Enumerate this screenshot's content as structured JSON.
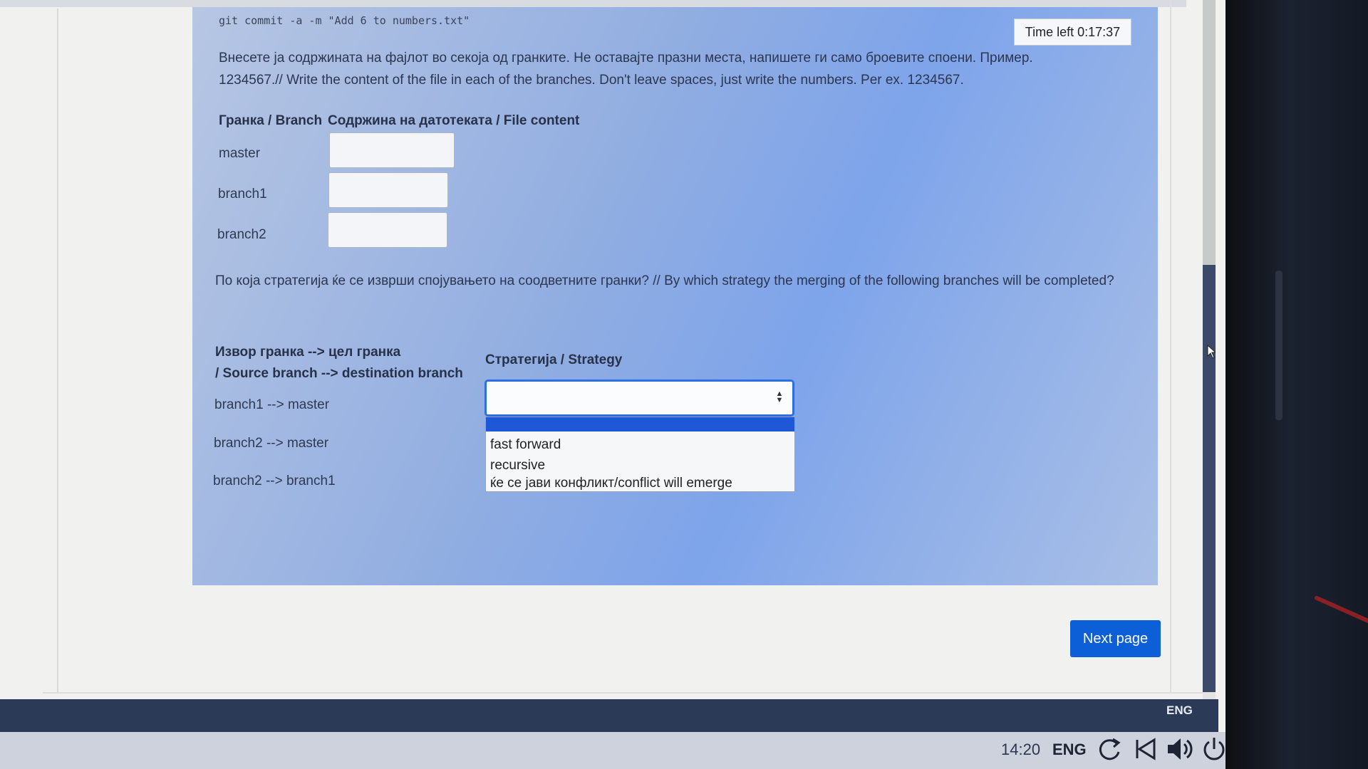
{
  "exam": {
    "command_line": "git commit -a -m \"Add 6 to numbers.txt\"",
    "timer": "Time left 0:17:37",
    "instructions": "Внесете ја содржината на фајлот во секоја од гранките. Не оставајте празни места, напишете ги само броевите споени. Пример. 1234567.// Write the content of the file in each of the branches. Don't leave spaces, just write the numbers. Per ex. 1234567.",
    "table1": {
      "header_branch": "Гранка / Branch",
      "header_content": "Содржина на датотеката / File content",
      "rows": [
        {
          "label": "master",
          "value": ""
        },
        {
          "label": "branch1",
          "value": ""
        },
        {
          "label": "branch2",
          "value": ""
        }
      ]
    },
    "question": "По која стратегија ќе се изврши спојувањето на соодветните гранки? // By which strategy the merging of the following branches will be completed?",
    "table2": {
      "header_source_line1": "Извор гранка --> цел гранка",
      "header_source_line2": "/ Source branch --> destination branch",
      "header_strategy": "Стратегија / Strategy",
      "rows": [
        "branch1 --> master",
        "branch2 --> master",
        "branch2 --> branch1"
      ],
      "select_value": "",
      "options": [
        "fast forward",
        "recursive",
        "ќе се јави конфликт/conflict will emerge"
      ]
    },
    "next_button": "Next page"
  },
  "taskbar": {
    "language_top": "ENG",
    "clock": "14:20",
    "language": "ENG",
    "icons": [
      "refresh-icon",
      "back-icon",
      "volume-icon",
      "power-icon"
    ]
  },
  "colors": {
    "panel": "#92aee1",
    "accent": "#0d5fd8",
    "select_border": "#2d6fe0",
    "taskbar": "#2b3a57"
  }
}
